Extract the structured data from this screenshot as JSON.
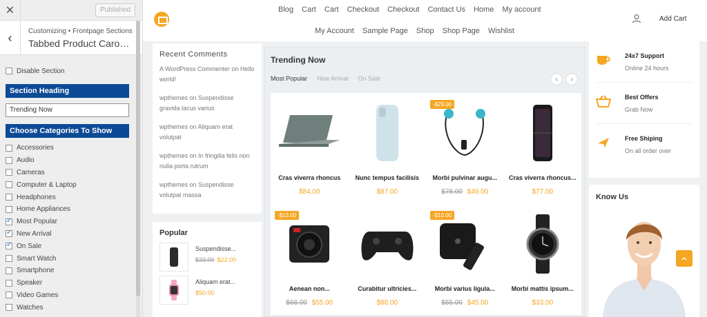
{
  "customizer": {
    "close_label": "✕",
    "publish_label": "Published",
    "back_label": "‹",
    "breadcrumb": "Customizing • Frontpage Sections",
    "title": "Tabbed Product Carou...",
    "disable_section_label": "Disable Section",
    "section_heading_label": "Section Heading",
    "section_heading_value": "Trending Now",
    "categories_heading": "Choose Categories To Show",
    "categories": [
      {
        "label": "Accessories",
        "checked": false
      },
      {
        "label": "Audio",
        "checked": false
      },
      {
        "label": "Cameras",
        "checked": false
      },
      {
        "label": "Computer & Laptop",
        "checked": false
      },
      {
        "label": "Headphones",
        "checked": false
      },
      {
        "label": "Home Appliances",
        "checked": false
      },
      {
        "label": "Most Popular",
        "checked": true
      },
      {
        "label": "New Arrival",
        "checked": true
      },
      {
        "label": "On Sale",
        "checked": true
      },
      {
        "label": "Smart Watch",
        "checked": false
      },
      {
        "label": "Smartphone",
        "checked": false
      },
      {
        "label": "Speaker",
        "checked": false
      },
      {
        "label": "Video Games",
        "checked": false
      },
      {
        "label": "Watches",
        "checked": false
      }
    ]
  },
  "header": {
    "nav_row1": [
      "Blog",
      "Cart",
      "Cart",
      "Checkout",
      "Checkout",
      "Contact Us",
      "Home",
      "My account"
    ],
    "nav_row2": [
      "My Account",
      "Sample Page",
      "Shop",
      "Shop Page",
      "Wishlist"
    ],
    "add_cart_label": "Add Cart"
  },
  "recent_comments": {
    "title": "Recent Comments",
    "items": [
      "A WordPress Commenter on Hello world!",
      "wpthemes on Suspendisse gravida lacus varius",
      "wpthemes on Aliquam erat volutpat",
      "wpthemes on In fringilla felis non nulla porta rutrum",
      "wpthemes on Suspendisse volutpat massa"
    ]
  },
  "popular": {
    "title": "Popular",
    "items": [
      {
        "name": "Suspendisse...",
        "old_price": "$33.00",
        "price": "$22.00"
      },
      {
        "name": "Aliquam erat...",
        "old_price": "",
        "price": "$50.00"
      }
    ]
  },
  "trending": {
    "title": "Trending Now",
    "tabs": [
      "Most Popular",
      "New Arrival",
      "On Sale"
    ],
    "active_tab": "Most Popular",
    "prev_label": "‹",
    "next_label": "›",
    "products": [
      {
        "name": "Cras viverra rhoncus",
        "old_price": "",
        "price": "$84.00",
        "badge": "",
        "icon": "laptop-icon"
      },
      {
        "name": "Nunc tempus facilisis",
        "old_price": "",
        "price": "$87.00",
        "badge": "",
        "icon": "phone-icon"
      },
      {
        "name": "Morbi pulvinar augu...",
        "old_price": "$78.00",
        "price": "$49.00",
        "badge": "-$29.00",
        "icon": "earphones-icon"
      },
      {
        "name": "Cras viverra rhoncus...",
        "old_price": "",
        "price": "$77.00",
        "badge": "",
        "icon": "flip-phone-icon"
      },
      {
        "name": "Aenean non...",
        "old_price": "$68.00",
        "price": "$55.00",
        "badge": "-$13.00",
        "icon": "camera-icon"
      },
      {
        "name": "Curabitur ultricies...",
        "old_price": "",
        "price": "$88.00",
        "badge": "",
        "icon": "gamepad-icon"
      },
      {
        "name": "Morbi varius ligula...",
        "old_price": "$55.00",
        "price": "$45.00",
        "badge": "-$10.00",
        "icon": "tv-box-icon"
      },
      {
        "name": "Morbi mattis ipsum...",
        "old_price": "",
        "price": "$33.00",
        "badge": "",
        "icon": "watch-icon"
      }
    ]
  },
  "support": [
    {
      "title": "24x7 Support",
      "subtitle": "Online 24 hours",
      "icon": "cup-icon"
    },
    {
      "title": "Best Offers",
      "subtitle": "Grab Now",
      "icon": "basket-icon"
    },
    {
      "title": "Free Shiping",
      "subtitle": "On all order over",
      "icon": "plane-icon"
    }
  ],
  "know_us": {
    "title": "Know Us"
  },
  "colors": {
    "accent": "#f5a623",
    "customizer_blue": "#0c4a96"
  }
}
